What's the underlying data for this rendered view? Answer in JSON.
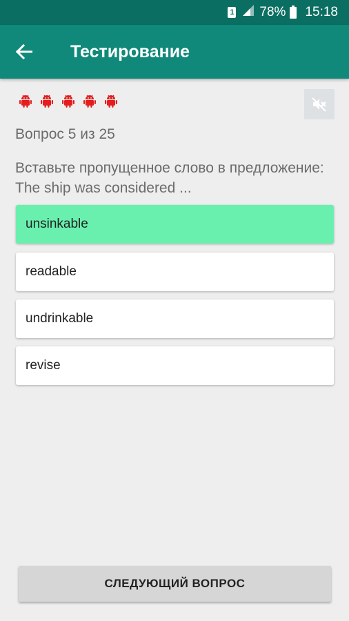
{
  "status_bar": {
    "sim": "1",
    "battery": "78%",
    "time": "15:18"
  },
  "app_bar": {
    "title": "Тестирование"
  },
  "lives": {
    "count": 5,
    "icon": "android-icon",
    "color": "#e41e1e"
  },
  "question": {
    "counter": "Вопрос 5 из 25",
    "text": "Вставьте пропущенное слово в предложение: The ship was considered ..."
  },
  "answers": [
    {
      "label": "unsinkable",
      "state": "correct"
    },
    {
      "label": "readable",
      "state": "normal"
    },
    {
      "label": "undrinkable",
      "state": "normal"
    },
    {
      "label": "revise",
      "state": "normal"
    }
  ],
  "next_button": {
    "label": "СЛЕДУЮЩИЙ ВОПРОС"
  },
  "colors": {
    "status_bar": "#0b6e62",
    "app_bar": "#10897a",
    "correct_answer": "#69f0ae",
    "background": "#eeeeee"
  }
}
